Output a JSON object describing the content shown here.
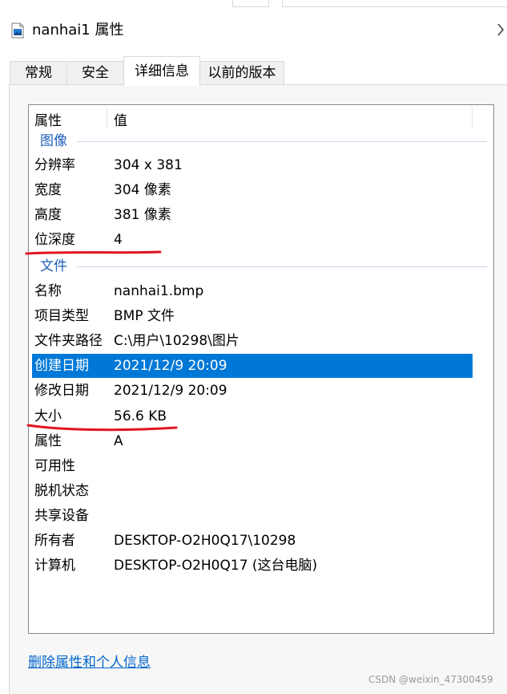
{
  "window": {
    "title": "nanhai1 属性",
    "title_icon": "bitmap-file-icon",
    "chevron_icon": "chevron-right-icon"
  },
  "tabs": [
    {
      "label": "常规"
    },
    {
      "label": "安全"
    },
    {
      "label": "详细信息"
    },
    {
      "label": "以前的版本"
    }
  ],
  "active_tab": "详细信息",
  "list": {
    "columns": {
      "property": "属性",
      "value": "值"
    },
    "groups": [
      {
        "name": "图像",
        "rows": [
          {
            "key": "分辨率",
            "value": "304 x 381"
          },
          {
            "key": "宽度",
            "value": "304 像素"
          },
          {
            "key": "高度",
            "value": "381 像素"
          },
          {
            "key": "位深度",
            "value": "4"
          }
        ]
      },
      {
        "name": "文件",
        "rows": [
          {
            "key": "名称",
            "value": "nanhai1.bmp"
          },
          {
            "key": "项目类型",
            "value": "BMP 文件"
          },
          {
            "key": "文件夹路径",
            "value": "C:\\用户\\10298\\图片"
          },
          {
            "key": "创建日期",
            "value": "2021/12/9 20:09"
          },
          {
            "key": "修改日期",
            "value": "2021/12/9 20:09"
          },
          {
            "key": "大小",
            "value": "56.6 KB"
          },
          {
            "key": "属性",
            "value": "A"
          },
          {
            "key": "可用性",
            "value": ""
          },
          {
            "key": "脱机状态",
            "value": ""
          },
          {
            "key": "共享设备",
            "value": ""
          },
          {
            "key": "所有者",
            "value": "DESKTOP-O2H0Q17\\10298"
          },
          {
            "key": "计算机",
            "value": "DESKTOP-O2H0Q17 (这台电脑)"
          }
        ]
      }
    ],
    "selected_row": "创建日期"
  },
  "footer": {
    "remove_link": "删除属性和个人信息"
  },
  "watermark": "CSDN @weixin_47300459",
  "colors": {
    "selection": "#0078d7",
    "group_label": "#1e5fb4",
    "annotation": "#e0141e",
    "link": "#0066cc"
  }
}
